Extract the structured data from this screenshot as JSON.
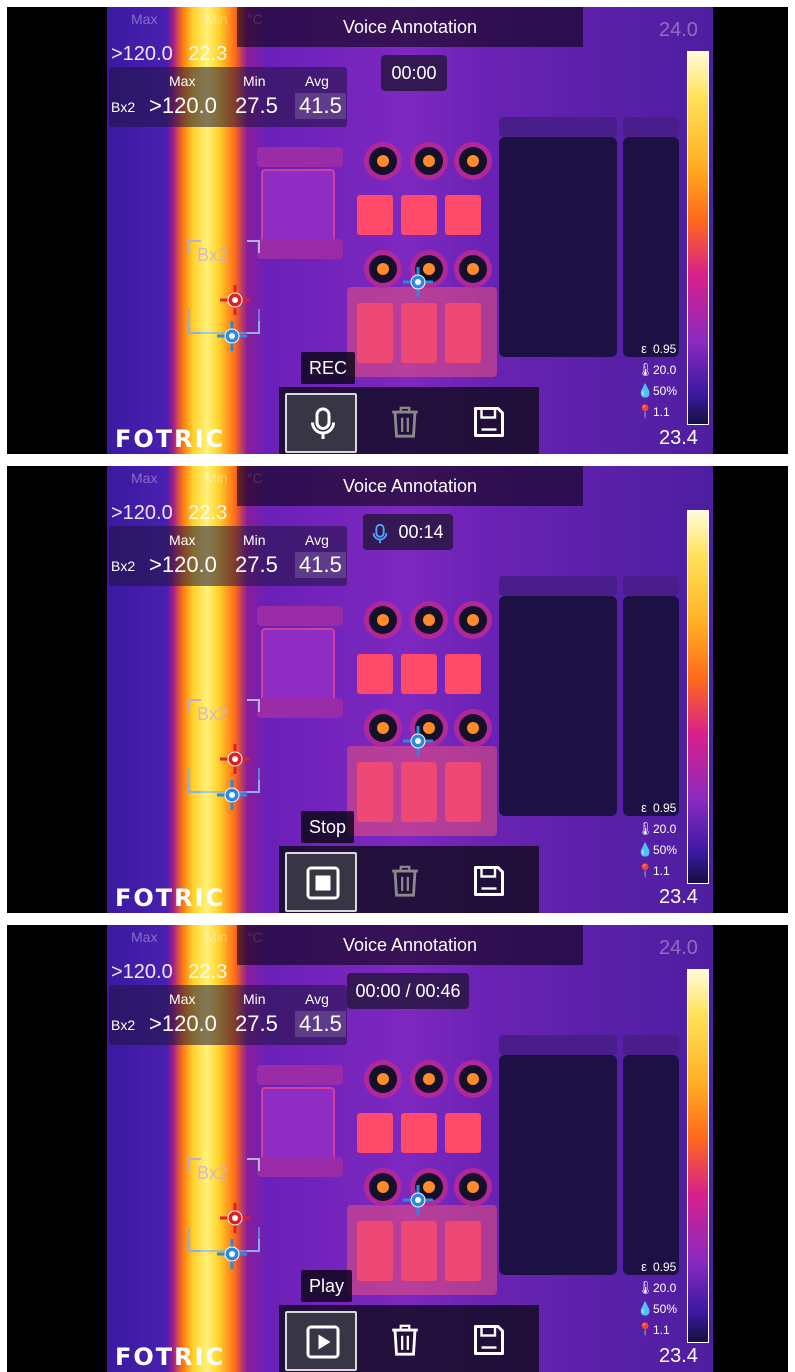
{
  "panels": [
    {
      "title": "Voice Annotation",
      "ghost_header": {
        "max": "Max",
        "min": "Min",
        "unit": "°C"
      },
      "row1": {
        "max": ">120.0",
        "min": "22.3"
      },
      "measure": {
        "label_max": "Max",
        "label_min": "Min",
        "label_avg": "Avg",
        "name": "Bx2",
        "max": ">120.0",
        "min": "27.5",
        "avg": "41.5"
      },
      "timer": "00:00",
      "show_mic_icon": false,
      "scale_top": "24.0",
      "scale_bottom": "23.4",
      "params": {
        "emissivity": "0.95",
        "temp": "20.0",
        "humidity": "50%",
        "distance": "1.1"
      },
      "tooltip": "REC",
      "primary_action": "mic",
      "box_label": "Bx2",
      "logo": "FOTRIC"
    },
    {
      "title": "Voice Annotation",
      "ghost_header": {
        "max": "Max",
        "min": "Min",
        "unit": "°C"
      },
      "row1": {
        "max": ">120.0",
        "min": "22.3"
      },
      "measure": {
        "label_max": "Max",
        "label_min": "Min",
        "label_avg": "Avg",
        "name": "Bx2",
        "max": ">120.0",
        "min": "27.5",
        "avg": "41.5"
      },
      "timer": "00:14",
      "show_mic_icon": true,
      "scale_top": "",
      "scale_bottom": "23.4",
      "params": {
        "emissivity": "0.95",
        "temp": "20.0",
        "humidity": "50%",
        "distance": "1.1"
      },
      "tooltip": "Stop",
      "primary_action": "stop",
      "box_label": "Bx2",
      "logo": "FOTRIC"
    },
    {
      "title": "Voice Annotation",
      "ghost_header": {
        "max": "Max",
        "min": "Min",
        "unit": "°C"
      },
      "row1": {
        "max": ">120.0",
        "min": "22.3"
      },
      "measure": {
        "label_max": "Max",
        "label_min": "Min",
        "label_avg": "Avg",
        "name": "Bx2",
        "max": ">120.0",
        "min": "27.5",
        "avg": "41.5"
      },
      "timer": "00:00 / 00:46",
      "show_mic_icon": false,
      "scale_top": "24.0",
      "scale_bottom": "23.4",
      "params": {
        "emissivity": "0.95",
        "temp": "20.0",
        "humidity": "50%",
        "distance": "1.1"
      },
      "tooltip": "Play",
      "primary_action": "play",
      "box_label": "Bx2",
      "logo": "FOTRIC"
    }
  ],
  "icons": {
    "delete": "trash-icon",
    "save": "floppy-disk-icon",
    "mic": "microphone-icon",
    "stop": "stop-icon",
    "play": "play-icon"
  }
}
